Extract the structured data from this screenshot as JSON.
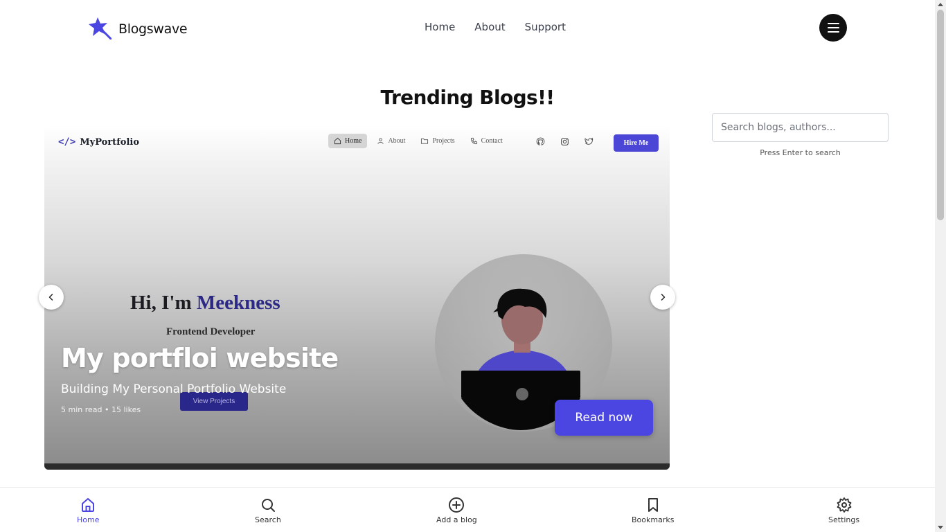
{
  "brand": {
    "name": "Blogswave",
    "accent": "#4b45e2",
    "logo_icon": "star-icon"
  },
  "nav": {
    "items": [
      "Home",
      "About",
      "Support"
    ],
    "menu_icon": "hamburger-icon"
  },
  "section_title": "Trending Blogs!!",
  "carousel": {
    "slide": {
      "title": "My portfloi website",
      "subtitle": "Building My Personal Portfolio Website",
      "meta": "5 min read • 15 likes",
      "cta": "Read now",
      "image": {
        "logo": "MyPortfolio",
        "nav": [
          "Home",
          "About",
          "Projects",
          "Contact"
        ],
        "social_icons": [
          "github-icon",
          "instagram-icon",
          "twitter-icon"
        ],
        "hire": "Hire Me",
        "greeting": "Hi, I'm ",
        "name": "Meekness",
        "role": "Frontend Developer",
        "view": "View Projects"
      }
    },
    "prev_icon": "chevron-left-icon",
    "next_icon": "chevron-right-icon"
  },
  "search": {
    "placeholder": "Search blogs, authors...",
    "hint": "Press Enter to search"
  },
  "bottom_nav": {
    "items": [
      {
        "label": "Home",
        "icon": "home-icon",
        "active": true
      },
      {
        "label": "Search",
        "icon": "search-icon",
        "active": false
      },
      {
        "label": "Add a blog",
        "icon": "plus-circle-icon",
        "active": false
      },
      {
        "label": "Bookmarks",
        "icon": "bookmark-icon",
        "active": false
      },
      {
        "label": "Settings",
        "icon": "gear-icon",
        "active": false
      }
    ]
  }
}
